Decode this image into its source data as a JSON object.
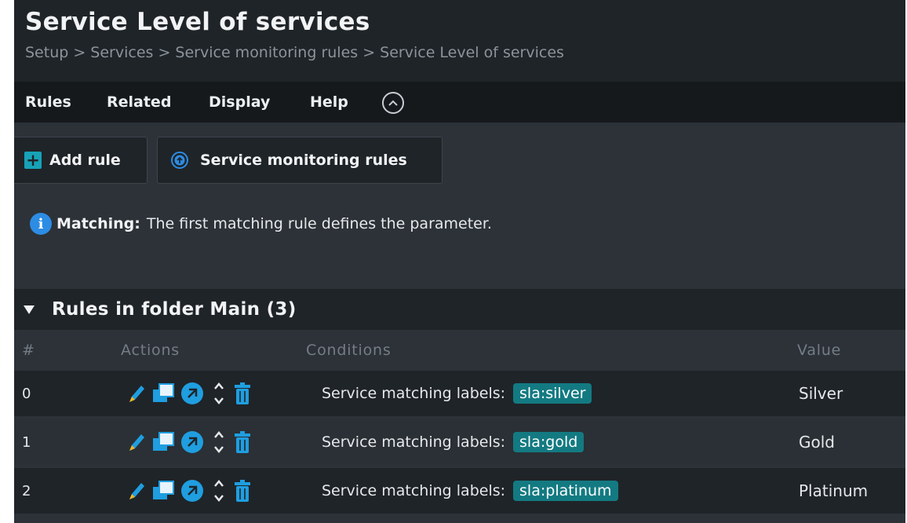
{
  "header": {
    "title": "Service Level of services",
    "breadcrumb": "Setup > Services > Service monitoring rules > Service Level of services"
  },
  "menu": {
    "items": [
      "Rules",
      "Related",
      "Display",
      "Help"
    ]
  },
  "toolbar": {
    "add_rule": "Add rule",
    "service_monitoring_rules": "Service monitoring rules"
  },
  "info": {
    "strong": "Matching:",
    "text": "The first matching rule defines the parameter."
  },
  "folder": {
    "title": "Rules in folder Main (3)"
  },
  "table": {
    "columns": {
      "num": "#",
      "actions": "Actions",
      "conditions": "Conditions",
      "value": "Value"
    },
    "rows": [
      {
        "num": "0",
        "condition_label": "Service matching labels:",
        "tag": "sla:silver",
        "value": "Silver"
      },
      {
        "num": "1",
        "condition_label": "Service matching labels:",
        "tag": "sla:gold",
        "value": "Gold"
      },
      {
        "num": "2",
        "condition_label": "Service matching labels:",
        "tag": "sla:platinum",
        "value": "Platinum"
      }
    ]
  },
  "colors": {
    "accent": "#17a2b8",
    "tag_bg": "#137a82",
    "info_blue": "#2d8ce3",
    "edit_blue": "#1f9ee0"
  },
  "icons": {
    "edit": "pencil-icon",
    "clone": "clone-icon",
    "move": "move-arrow-icon",
    "sort": "sort-updown-icon",
    "delete": "trash-icon"
  }
}
